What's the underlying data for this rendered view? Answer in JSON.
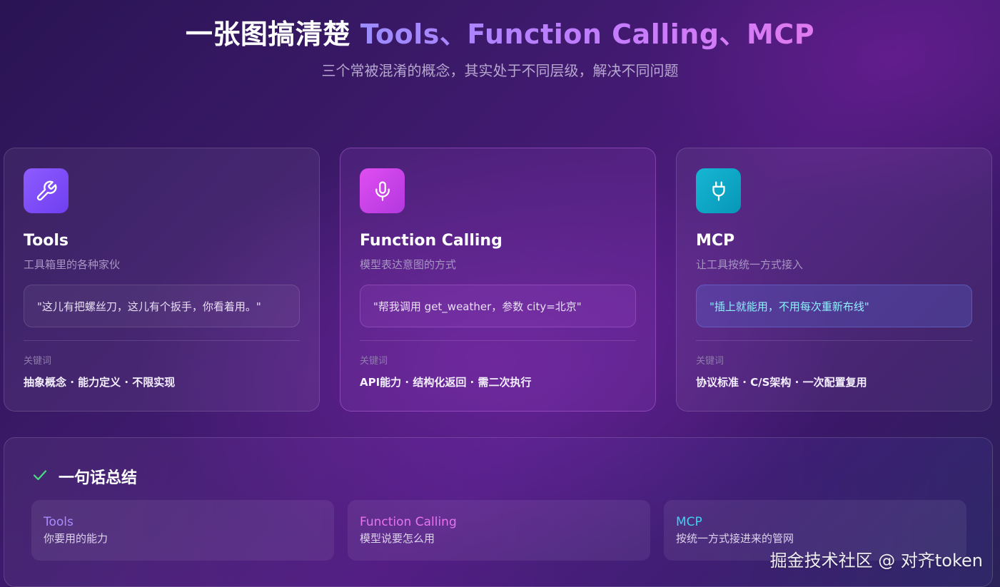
{
  "header": {
    "title_lead": "一张图搞清楚",
    "title_highlight": "Tools、Function Calling、MCP",
    "subtitle": "三个常被混淆的概念，其实处于不同层级，解决不同问题"
  },
  "cards": [
    {
      "icon": "wrench-icon",
      "title": "Tools",
      "desc": "工具箱里的各种家伙",
      "quote": "\"这儿有把螺丝刀，这儿有个扳手，你看着用。\"",
      "kw_label": "关键词",
      "keywords": "抽象概念 · 能力定义 · 不限实现"
    },
    {
      "icon": "microphone-icon",
      "title": "Function Calling",
      "desc": "模型表达意图的方式",
      "quote": "\"帮我调用 get_weather，参数 city=北京\"",
      "kw_label": "关键词",
      "keywords": "API能力 · 结构化返回 · 需二次执行"
    },
    {
      "icon": "plug-icon",
      "title": "MCP",
      "desc": "让工具按统一方式接入",
      "quote": "\"插上就能用，不用每次重新布线\"",
      "kw_label": "关键词",
      "keywords": "协议标准 · C/S架构 · 一次配置复用"
    }
  ],
  "summary": {
    "title": "一句话总结",
    "items": [
      {
        "name": "Tools",
        "text": "你要用的能力"
      },
      {
        "name": "Function Calling",
        "text": "模型说要怎么用"
      },
      {
        "name": "MCP",
        "text": "按统一方式接进来的管网"
      }
    ]
  },
  "watermark": "掘金技术社区 @ 对齐token",
  "colors": {
    "tools": "#a98cff",
    "function_calling": "#e774f0",
    "mcp": "#3fd0f0",
    "check": "#4ade80"
  }
}
